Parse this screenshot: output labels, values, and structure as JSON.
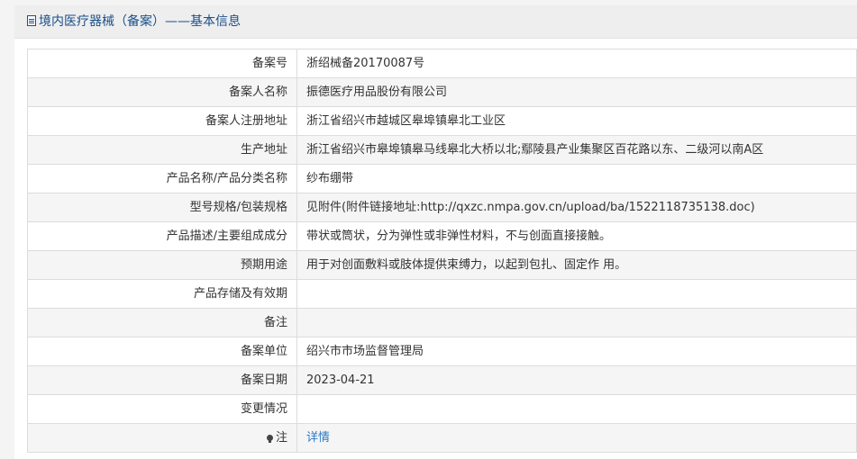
{
  "header": {
    "title": "境内医疗器械（备案）——基本信息",
    "icon": "document-icon"
  },
  "colors": {
    "header_text": "#1a4f8b",
    "link": "#2a7ac7",
    "stripe": "#f5f5f5"
  },
  "rows": [
    {
      "label": "备案号",
      "value": "浙绍械备20170087号"
    },
    {
      "label": "备案人名称",
      "value": "振德医疗用品股份有限公司"
    },
    {
      "label": "备案人注册地址",
      "value": "浙江省绍兴市越城区皋埠镇皋北工业区"
    },
    {
      "label": "生产地址",
      "value": "浙江省绍兴市皋埠镇皋马线皋北大桥以北;鄢陵县产业集聚区百花路以东、二级河以南A区"
    },
    {
      "label": "产品名称/产品分类名称",
      "value": "纱布绷带"
    },
    {
      "label": "型号规格/包装规格",
      "value": "见附件(附件链接地址:http://qxzc.nmpa.gov.cn/upload/ba/1522118735138.doc)"
    },
    {
      "label": "产品描述/主要组成成分",
      "value": "带状或筒状，分为弹性或非弹性材料，不与创面直接接触。"
    },
    {
      "label": "预期用途",
      "value": "用于对创面敷料或肢体提供束缚力，以起到包扎、固定作 用。"
    },
    {
      "label": "产品存储及有效期",
      "value": ""
    },
    {
      "label": "备注",
      "value": ""
    },
    {
      "label": "备案单位",
      "value": "绍兴市市场监督管理局"
    },
    {
      "label": "备案日期",
      "value": "2023-04-21"
    },
    {
      "label": "变更情况",
      "value": ""
    }
  ],
  "note_row": {
    "label": "注",
    "link_text": "详情",
    "icon": "lightbulb-icon"
  }
}
